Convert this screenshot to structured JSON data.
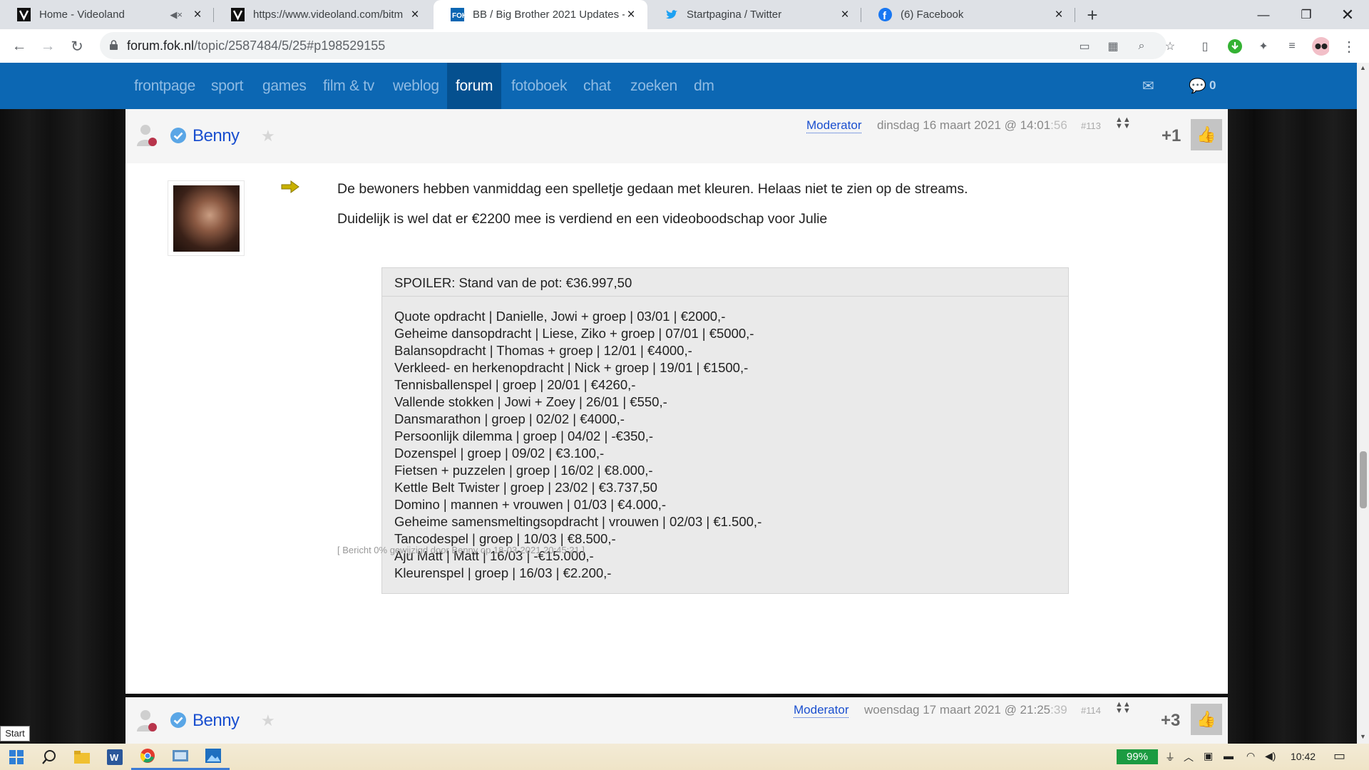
{
  "browser": {
    "tabs": [
      {
        "title": "Home - Videoland",
        "muted": true
      },
      {
        "title": "https://www.videoland.com/bitm"
      },
      {
        "title": "BB / Big Brother 2021 Updates - "
      },
      {
        "title": "Startpagina / Twitter"
      },
      {
        "title": "(6) Facebook"
      }
    ],
    "url": {
      "host": "forum.fok.nl",
      "path": "/topic/2587484/5/25#p198529155"
    }
  },
  "site_nav": {
    "items": [
      "frontpage",
      "sport",
      "games",
      "film & tv",
      "weblog",
      "forum",
      "fotoboek",
      "chat",
      "zoeken",
      "dm"
    ],
    "active": "forum",
    "notification_count": "0"
  },
  "post": {
    "username": "Benny",
    "role": "Moderator",
    "date": "dinsdag 16 maart 2021 @ 14:01",
    "seconds": ":56",
    "number": "#113",
    "score": "+1",
    "paragraphs": [
      "De bewoners hebben vanmiddag een spelletje gedaan met kleuren. Helaas niet te zien op de streams.",
      "Duidelijk is wel dat er €2200 mee is verdiend en een videoboodschap voor Julie"
    ],
    "spoiler": {
      "title": "SPOILER: Stand van de pot: €36.997,50",
      "lines": [
        "Quote opdracht | Danielle, Jowi + groep | 03/01 | €2000,-",
        "Geheime dansopdracht | Liese, Ziko + groep | 07/01 | €5000,-",
        "Balansopdracht | Thomas + groep | 12/01 | €4000,-",
        "Verkleed- en herkenopdracht | Nick + groep | 19/01 | €1500,-",
        "Tennisballenspel | groep | 20/01 | €4260,-",
        "Vallende stokken | Jowi + Zoey | 26/01 | €550,-",
        "Dansmarathon | groep | 02/02 | €4000,-",
        "Persoonlijk dilemma | groep | 04/02 | -€350,-",
        "Dozenspel | groep | 09/02 | €3.100,-",
        "Fietsen + puzzelen | groep | 16/02 | €8.000,-",
        "Kettle Belt Twister | groep | 23/02 | €3.737,50",
        "Domino | mannen + vrouwen | 01/03 | €4.000,-",
        "Geheime samensmeltingsopdracht | vrouwen | 02/03 | €1.500,-",
        "Tancodespel | groep | 10/03 | €8.500,-",
        "Aju Matt | Matt | 16/03 | -€15.000,-",
        "Kleurenspel | groep | 16/03 | €2.200,-"
      ]
    },
    "edited": "[ Bericht 0% gewijzigd door Benny op 18-03-2021 20:45:21 ]"
  },
  "next_post": {
    "username": "Benny",
    "role": "Moderator",
    "date": "woensdag 17 maart 2021 @ 21:25",
    "seconds": ":39",
    "number": "#114",
    "score": "+3"
  },
  "taskbar": {
    "battery": "99%",
    "time": "10:42",
    "start_tooltip": "Start"
  }
}
